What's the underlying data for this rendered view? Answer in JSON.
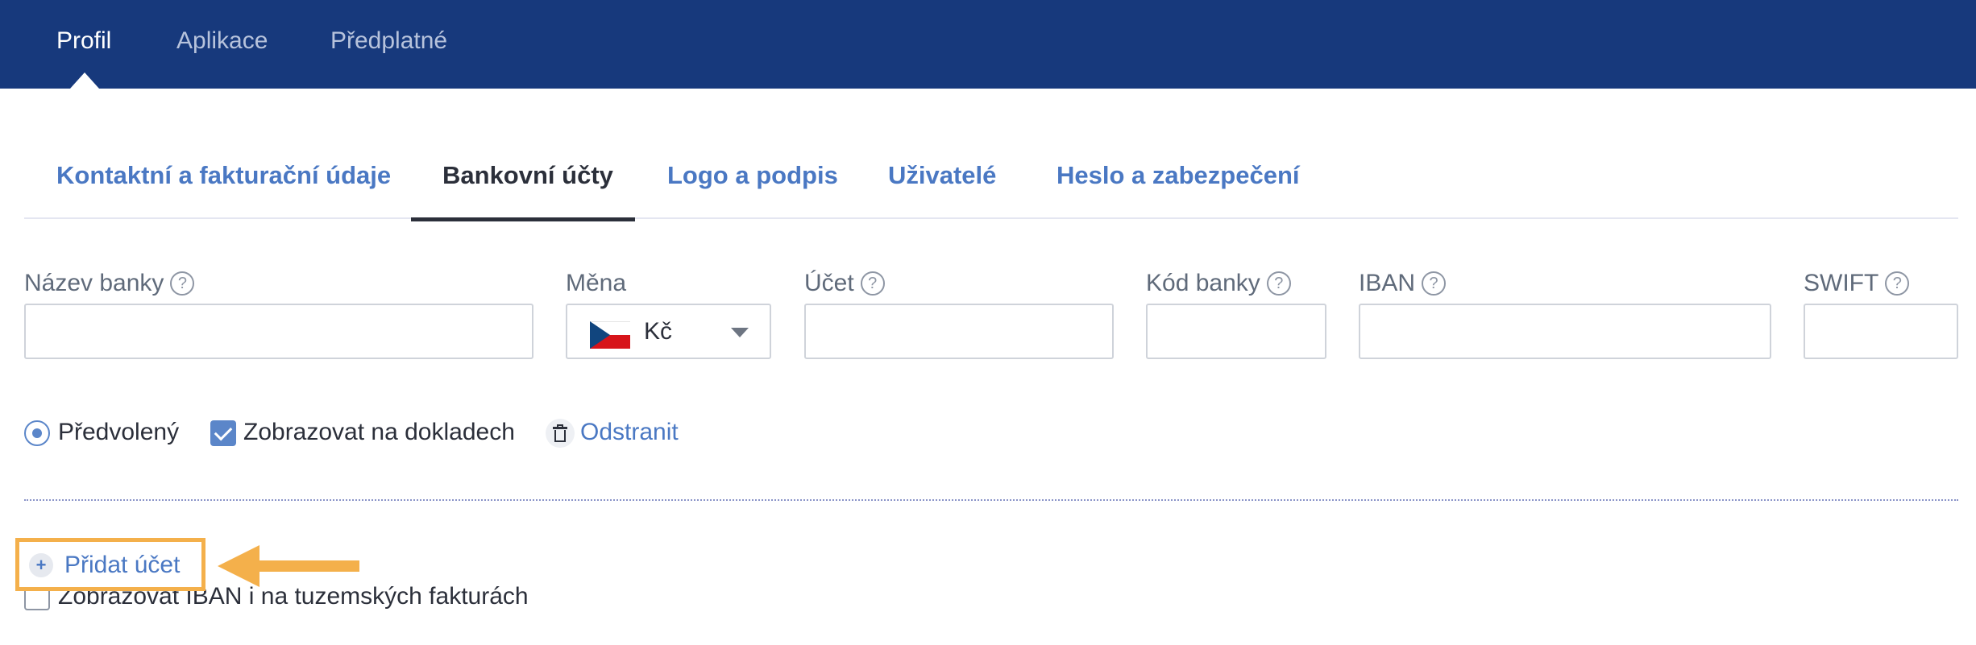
{
  "topnav": {
    "tabs": [
      {
        "label": "Profil"
      },
      {
        "label": "Aplikace"
      },
      {
        "label": "Předplatné"
      }
    ]
  },
  "subtabs": [
    {
      "label": "Kontaktní a fakturační údaje"
    },
    {
      "label": "Bankovní účty"
    },
    {
      "label": "Logo a podpis"
    },
    {
      "label": "Uživatelé"
    },
    {
      "label": "Heslo a zabezpečení"
    }
  ],
  "form": {
    "bank_name": {
      "label": "Název banky",
      "value": ""
    },
    "currency": {
      "label": "Měna",
      "value": "Kč"
    },
    "account": {
      "label": "Účet",
      "value": ""
    },
    "bank_code": {
      "label": "Kód banky",
      "value": ""
    },
    "iban": {
      "label": "IBAN",
      "value": ""
    },
    "swift": {
      "label": "SWIFT",
      "value": ""
    },
    "help_glyph": "?"
  },
  "options": {
    "default_label": "Předvolený",
    "show_on_docs_label": "Zobrazovat na dokladech",
    "remove_label": "Odstranit"
  },
  "add_account": {
    "label": "Přidat účet",
    "plus": "+"
  },
  "iban_domestic": {
    "label": "Zobrazovat IBAN i na tuzemských fakturách"
  },
  "colors": {
    "nav_bg": "#17397c",
    "accent": "#4a78c3",
    "highlight": "#f4b04b"
  }
}
